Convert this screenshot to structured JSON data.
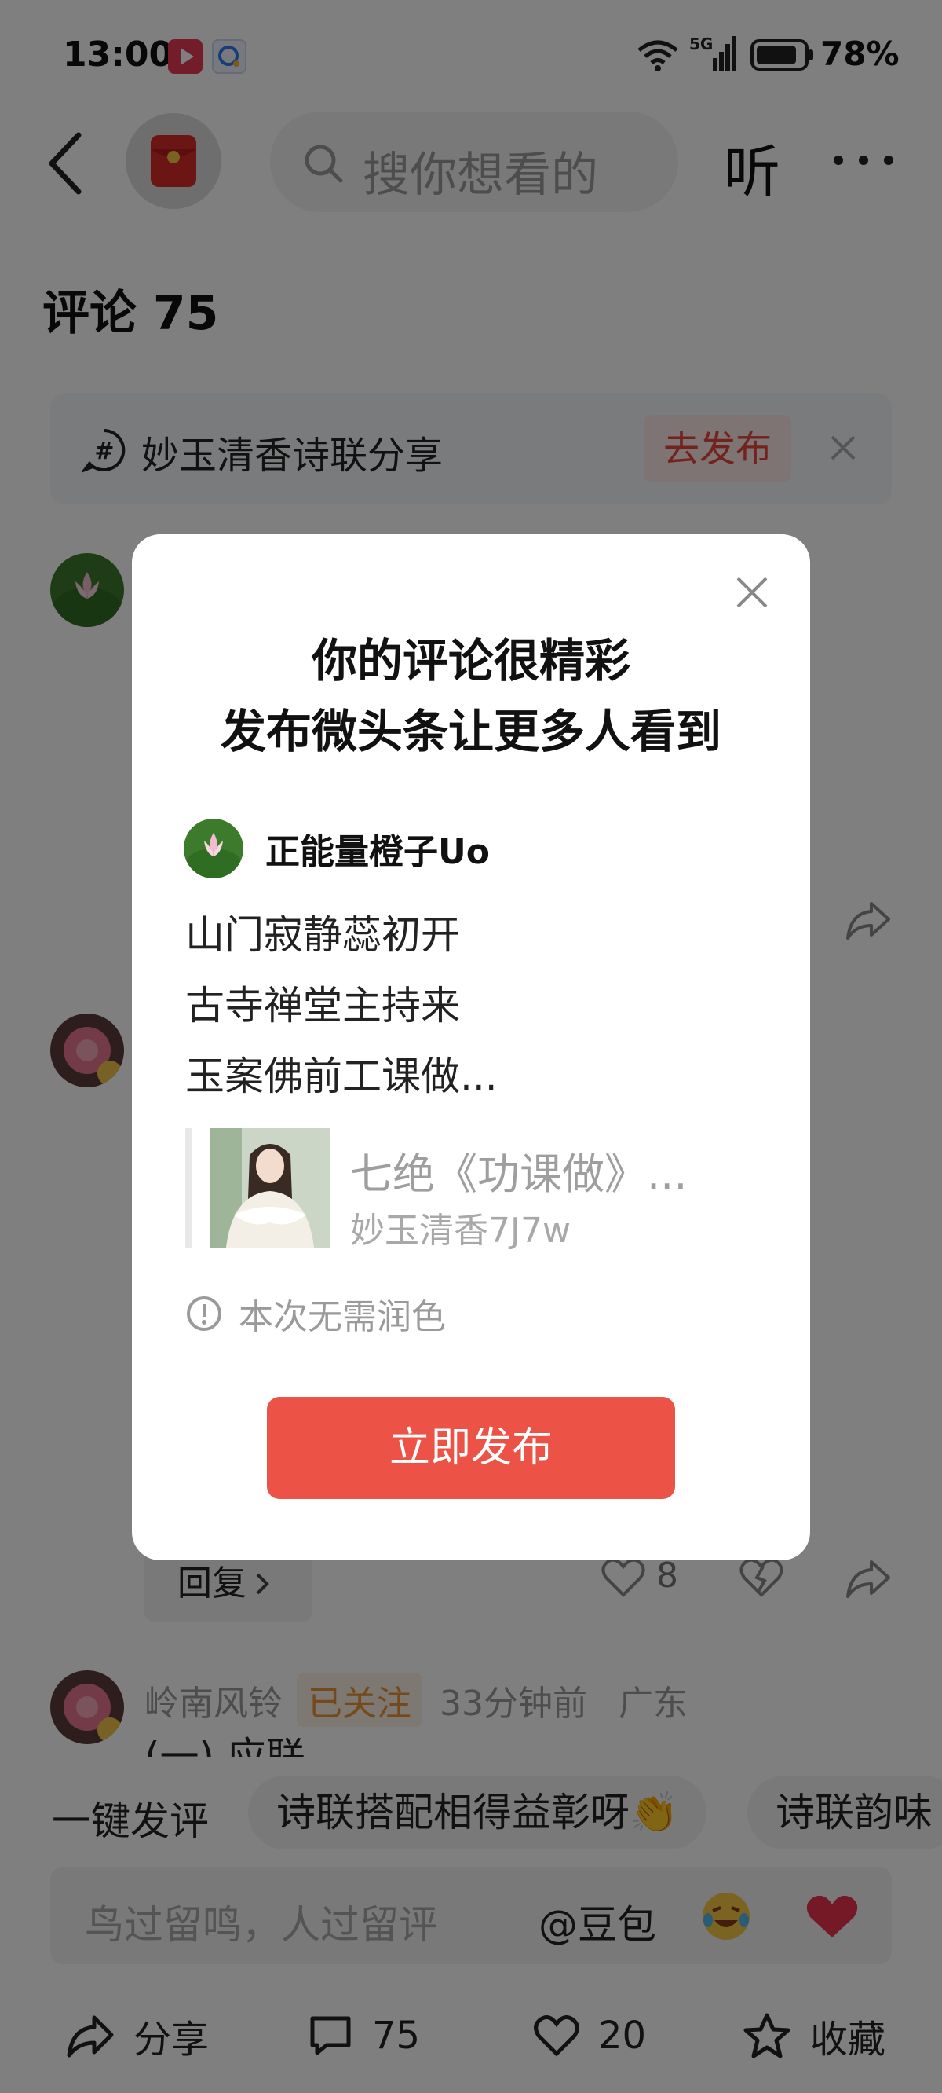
{
  "status_bar": {
    "time": "13:00",
    "network_label": "5G",
    "battery": "78%"
  },
  "header": {
    "search_placeholder": "搜你想看的",
    "listen_label": "听"
  },
  "comments": {
    "title": "评论 75",
    "topic": "妙玉清香诗联分享",
    "topic_action": "去发布",
    "reply_label": "回复",
    "like_count": "8",
    "next_comment": {
      "author": "岭南风铃",
      "follow_status": "已关注",
      "time": "33分钟前",
      "location": "广东",
      "text": "(一) 应联"
    }
  },
  "quick_comments": {
    "label": "一键发评",
    "chips": [
      "诗联搭配相得益彰呀👏",
      "诗联韵味"
    ]
  },
  "input_bar": {
    "placeholder": "鸟过留鸣，人过留评",
    "doubao": "@豆包"
  },
  "bottom_nav": {
    "share": "分享",
    "comments": "75",
    "likes": "20",
    "favorite": "收藏"
  },
  "modal": {
    "title_line1": "你的评论很精彩",
    "title_line2": "发布微头条让更多人看到",
    "author": "正能量橙子Uo",
    "poem_lines": [
      "山门寂静蕊初开",
      "古寺禅堂主持来",
      "玉案佛前工课做..."
    ],
    "quote_title": "七绝《功课做》...",
    "quote_author": "妙玉清香7J7w",
    "notice": "本次无需润色",
    "publish_button": "立即发布"
  },
  "colors": {
    "accent_red": "#ec5246",
    "overlay": "rgba(0,0,0,0.5)"
  }
}
